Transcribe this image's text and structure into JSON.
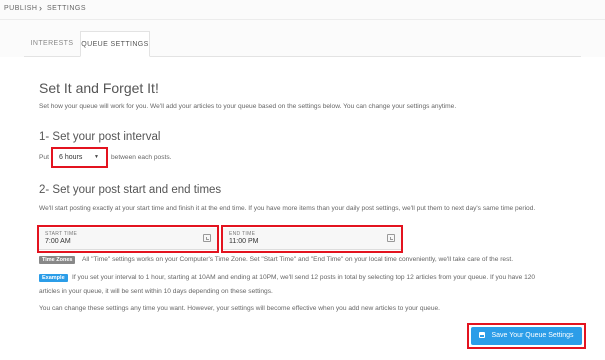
{
  "breadcrumb": {
    "items": [
      "PUBLISH",
      "SETTINGS"
    ],
    "separator": "›"
  },
  "tabs": [
    {
      "label": "INTERESTS",
      "active": false
    },
    {
      "label": "QUEUE SETTINGS",
      "active": true
    }
  ],
  "main": {
    "title": "Set It and Forget It!",
    "intro": "Set how your queue will work for you. We'll add your articles to your queue based on the settings below. You can change your settings anytime.",
    "interval": {
      "heading": "1- Set your post interval",
      "prefix": "Put",
      "value": "6 hours",
      "suffix": "between each posts."
    },
    "times": {
      "heading": "2- Set your post start and end times",
      "desc": "We'll start posting exactly at your start time and finish it at the end time. If you have more items than your daily post settings, we'll put them to next day's same time period.",
      "start_label": "START TIME",
      "start_value": "7:00 AM",
      "end_label": "END TIME",
      "end_value": "11:00 PM"
    },
    "timezone": {
      "badge": "Time Zones",
      "text": "All \"Time\" settings works on your Computer's Time Zone. Set \"Start Time\" and \"End Time\" on your local time conveniently, we'll take care of the rest."
    },
    "example": {
      "badge": "Example",
      "line1": "If you set your interval to 1 hour, starting at 10AM and ending at 10PM, we'll send 12 posts in total by selecting top 12 articles from your queue. If you have 120",
      "line2": "articles in your queue, it will be sent within 10 days depending on these settings."
    },
    "note": "You can change these settings any time you want. However, your settings will become effective when you add new articles to your queue.",
    "save_label": "Save Your Queue Settings"
  },
  "colors": {
    "accent": "#2b9de8",
    "highlight": "#e3131f"
  }
}
